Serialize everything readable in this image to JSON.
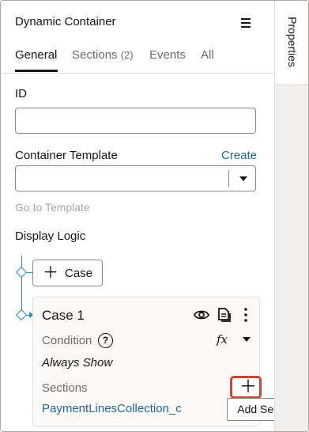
{
  "header": {
    "title": "Dynamic Container"
  },
  "tabs": [
    {
      "label": "General",
      "count": ""
    },
    {
      "label": "Sections",
      "count": "(2)"
    },
    {
      "label": "Events",
      "count": ""
    },
    {
      "label": "All",
      "count": ""
    }
  ],
  "active_tab": "General",
  "rail": {
    "label": "Properties"
  },
  "fields": {
    "id_label": "ID",
    "id_value": "",
    "template_label": "Container Template",
    "template_create_link": "Create",
    "template_value": "",
    "go_to_template": "Go to Template"
  },
  "display_logic": {
    "label": "Display Logic",
    "add_case_label": "Case",
    "case": {
      "title": "Case 1",
      "condition_label": "Condition",
      "fx_label": "fx",
      "condition_value": "Always Show",
      "sections_label": "Sections",
      "section_link": "PaymentLinesCollection_c"
    }
  },
  "tooltip": {
    "text": "Add Section"
  },
  "colors": {
    "link": "#1f6890",
    "tree": "#2d8cbe",
    "highlight": "#c74634"
  }
}
